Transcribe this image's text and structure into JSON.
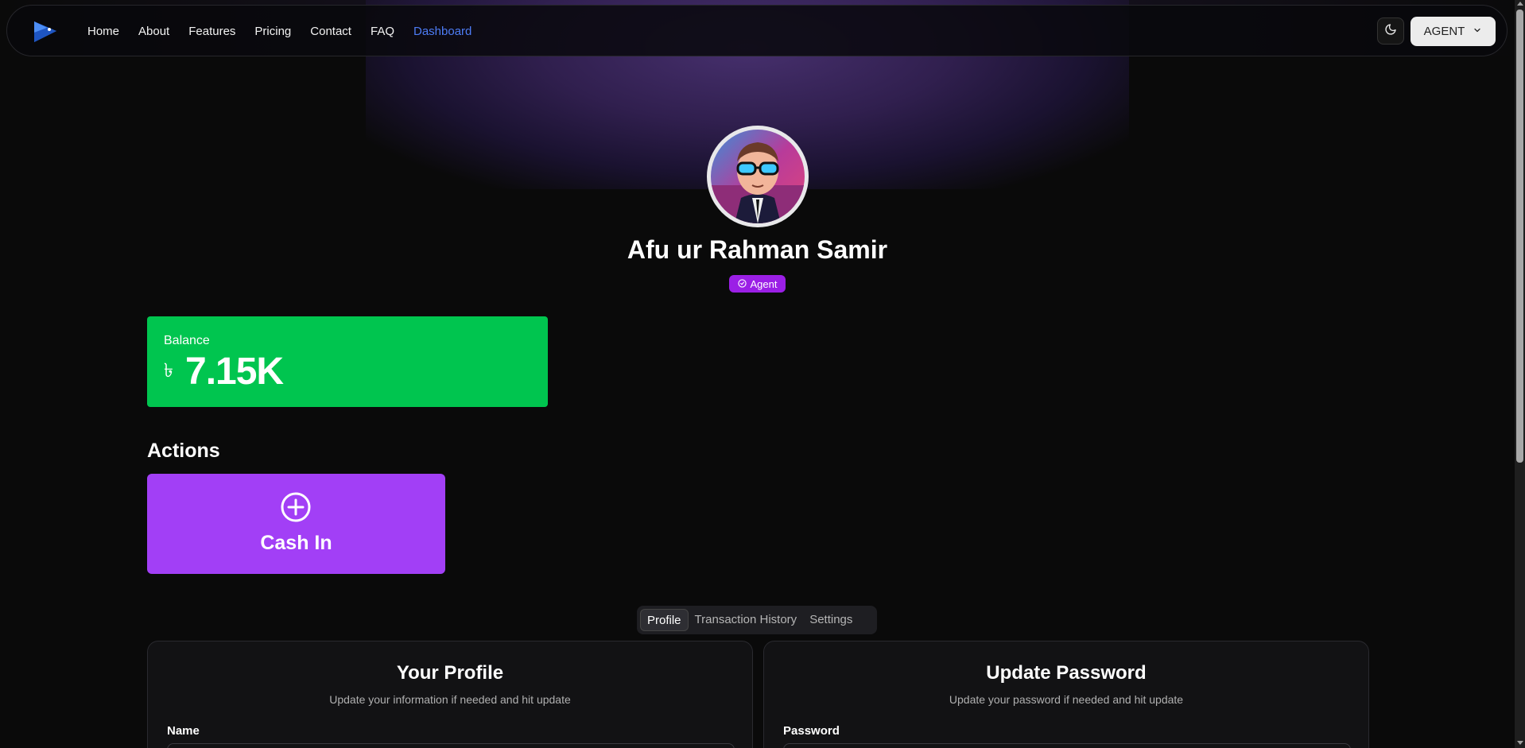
{
  "nav": {
    "logo": "logo-icon",
    "links": [
      "Home",
      "About",
      "Features",
      "Pricing",
      "Contact",
      "FAQ",
      "Dashboard"
    ],
    "active_link": "Dashboard",
    "theme_toggle_icon": "moon-icon",
    "role_menu_label": "AGENT"
  },
  "profile": {
    "name": "Afu ur Rahman Samir",
    "role_badge": "Agent"
  },
  "balance": {
    "label": "Balance",
    "currency_symbol": "৳",
    "amount": "7.15K"
  },
  "actions": {
    "title": "Actions",
    "cash_in_label": "Cash In"
  },
  "tabs": {
    "items": [
      "Profile",
      "Transaction History",
      "Settings"
    ],
    "active": "Profile"
  },
  "your_profile": {
    "title": "Your Profile",
    "subtitle": "Update your information if needed and hit update",
    "field_label": "Name"
  },
  "update_password": {
    "title": "Update Password",
    "subtitle": "Update your password if needed and hit update",
    "field_label": "Password"
  },
  "colors": {
    "accent_blue": "#4d7cf5",
    "balance_green": "#00c54f",
    "action_purple": "#a23ff6",
    "badge_purple": "#9b1fe6"
  }
}
